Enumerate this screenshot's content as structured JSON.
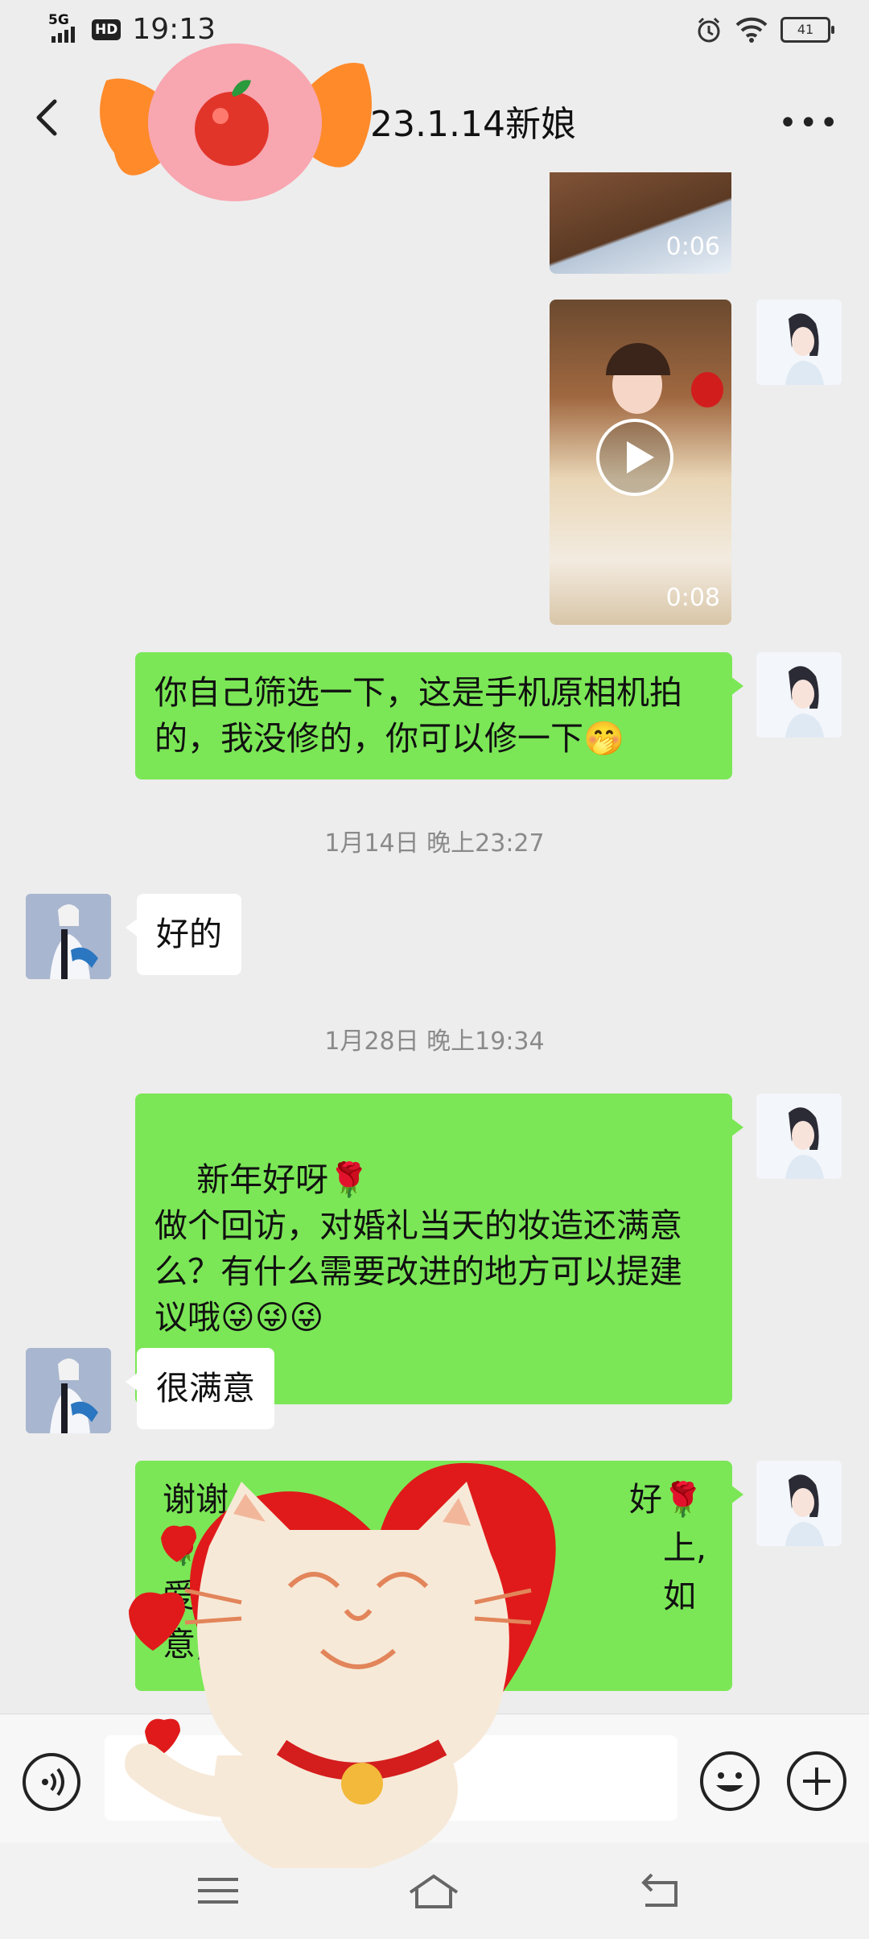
{
  "status_bar": {
    "network": "5G",
    "hd": "HD",
    "time": "19:13",
    "battery": "41"
  },
  "header": {
    "title": "23.1.14新娘"
  },
  "messages": [
    {
      "type": "video",
      "sender": "me",
      "duration": "0:06"
    },
    {
      "type": "video",
      "sender": "me",
      "duration": "0:08"
    },
    {
      "type": "text",
      "sender": "me",
      "text": "你自己筛选一下，这是手机原相机拍的，我没修的，你可以修一下🤭"
    },
    {
      "type": "timestamp",
      "text": "1月14日 晚上23:27"
    },
    {
      "type": "text",
      "sender": "other",
      "text": "好的"
    },
    {
      "type": "timestamp",
      "text": "1月28日 晚上19:34"
    },
    {
      "type": "text",
      "sender": "me",
      "text": "新年好呀🌹\n做个回访，对婚礼当天的妆造还满意么？有什么需要改进的地方可以提建议哦😜😜😜"
    },
    {
      "type": "text",
      "sender": "other",
      "text": "很满意"
    },
    {
      "type": "text",
      "sender": "me",
      "text_visible": [
        "谢谢",
        "好🌹",
        "🌹",
        "上,",
        "爱情",
        "如",
        "意,"
      ]
    }
  ],
  "colors": {
    "me_bubble": "#7be756",
    "other_bubble": "#ffffff",
    "background": "#ededed"
  },
  "icons": [
    "back-icon",
    "more-icon",
    "voice-icon",
    "emoji-icon",
    "plus-icon",
    "menu-icon",
    "home-icon",
    "back-nav-icon",
    "play-icon"
  ]
}
